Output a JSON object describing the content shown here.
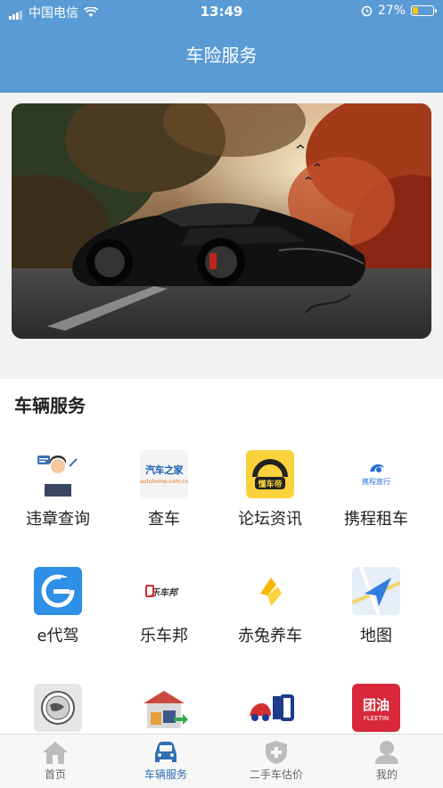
{
  "status_bar": {
    "carrier": "中国电信",
    "time": "13:49",
    "battery_percent": "27%",
    "battery_level": 0.27
  },
  "header": {
    "title": "车险服务"
  },
  "section": {
    "title": "车辆服务"
  },
  "services": [
    {
      "label": "违章查询",
      "icon": "traffic-officer-icon"
    },
    {
      "label": "查车",
      "icon": "autohome-logo-icon",
      "icon_text": "汽车之家",
      "icon_subtext": "autohome.com.cn"
    },
    {
      "label": "论坛资讯",
      "icon": "dongchedi-logo-icon",
      "icon_text": "懂车帝"
    },
    {
      "label": "携程租车",
      "icon": "ctrip-logo-icon",
      "icon_text": "携程旅行"
    },
    {
      "label": "e代驾",
      "icon": "edaijia-logo-icon"
    },
    {
      "label": "乐车邦",
      "icon": "lechebang-logo-icon",
      "icon_text": "乐车邦"
    },
    {
      "label": "赤兔养车",
      "icon": "chitu-logo-icon"
    },
    {
      "label": "地图",
      "icon": "map-navigation-icon"
    },
    {
      "label": "",
      "icon": "globe-seal-icon"
    },
    {
      "label": "",
      "icon": "moving-truck-icon"
    },
    {
      "label": "",
      "icon": "car-question-icon"
    },
    {
      "label": "",
      "icon": "tuanyou-logo-icon",
      "icon_text": "团油",
      "icon_subtext": "FLEETIN"
    }
  ],
  "tabs": [
    {
      "label": "首页",
      "icon": "home-icon"
    },
    {
      "label": "车辆服务",
      "icon": "car-icon",
      "active": true
    },
    {
      "label": "二手车估价",
      "icon": "shield-plus-icon"
    },
    {
      "label": "我的",
      "icon": "user-icon"
    }
  ],
  "colors": {
    "primary": "#5b9bd5",
    "active_tab": "#2f6fb3"
  }
}
